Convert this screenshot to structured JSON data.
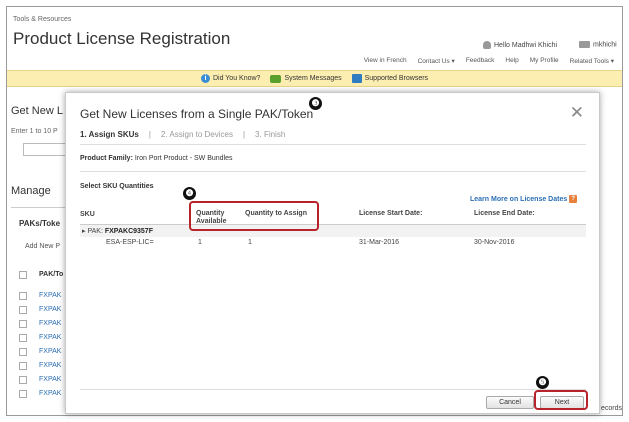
{
  "page": {
    "breadcrumb": "Tools & Resources",
    "title": "Product License Registration",
    "greeting": "Hello Madhwi Khichi",
    "userid": "mkhichi",
    "top_links": [
      "View in French",
      "Contact Us ▾",
      "Feedback",
      "Help",
      "My Profile",
      "Related Tools ▾"
    ],
    "notices": [
      "Did You Know?",
      "System Messages",
      "Supported Browsers"
    ],
    "bg_heading1": "Get New L",
    "bg_sub": "Enter 1 to 10 P",
    "bg_heading2": "Manage",
    "bg_column": "PAKs/Toke",
    "bg_add": "Add New P",
    "bg_pak_header": "PAK/To",
    "bg_rows": [
      "FXPAK",
      "FXPAK",
      "FXPAK",
      "FXPAK",
      "FXPAK",
      "FXPAK",
      "FXPAK",
      "FXPAK"
    ],
    "bg_records": "ecords"
  },
  "modal": {
    "title": "Get New Licenses from a Single PAK/Token",
    "close": "✕",
    "steps": [
      "1. Assign SKUs",
      "|",
      "2. Assign to Devices",
      "|",
      "3. Finish"
    ],
    "product_family_label": "Product Family:",
    "product_family_value": "Iron Port Product - SW Bundles",
    "select_label": "Select SKU Quantities",
    "learn_more": "Learn More on License Dates",
    "help_glyph": "?",
    "columns": {
      "sku": "SKU",
      "qty_available_1": "Quantity",
      "qty_available_2": "Available",
      "qty_assign": "Quantity to Assign",
      "start": "License Start Date:",
      "end": "License End Date:"
    },
    "pak_label": "PAK:",
    "pak_value": "FXPAKC9357F",
    "row": {
      "sku": "ESA-ESP-LIC=",
      "available": "1",
      "assign": "1",
      "start": "31-Mar-2016",
      "end": "30-Nov-2016"
    },
    "cancel": "Cancel",
    "next": "Next"
  },
  "callouts": [
    "❸",
    "❹",
    "❺"
  ],
  "colors": {
    "callout": "#b8222a",
    "link": "#2b6fb5",
    "notice": "#fbeeb0"
  }
}
